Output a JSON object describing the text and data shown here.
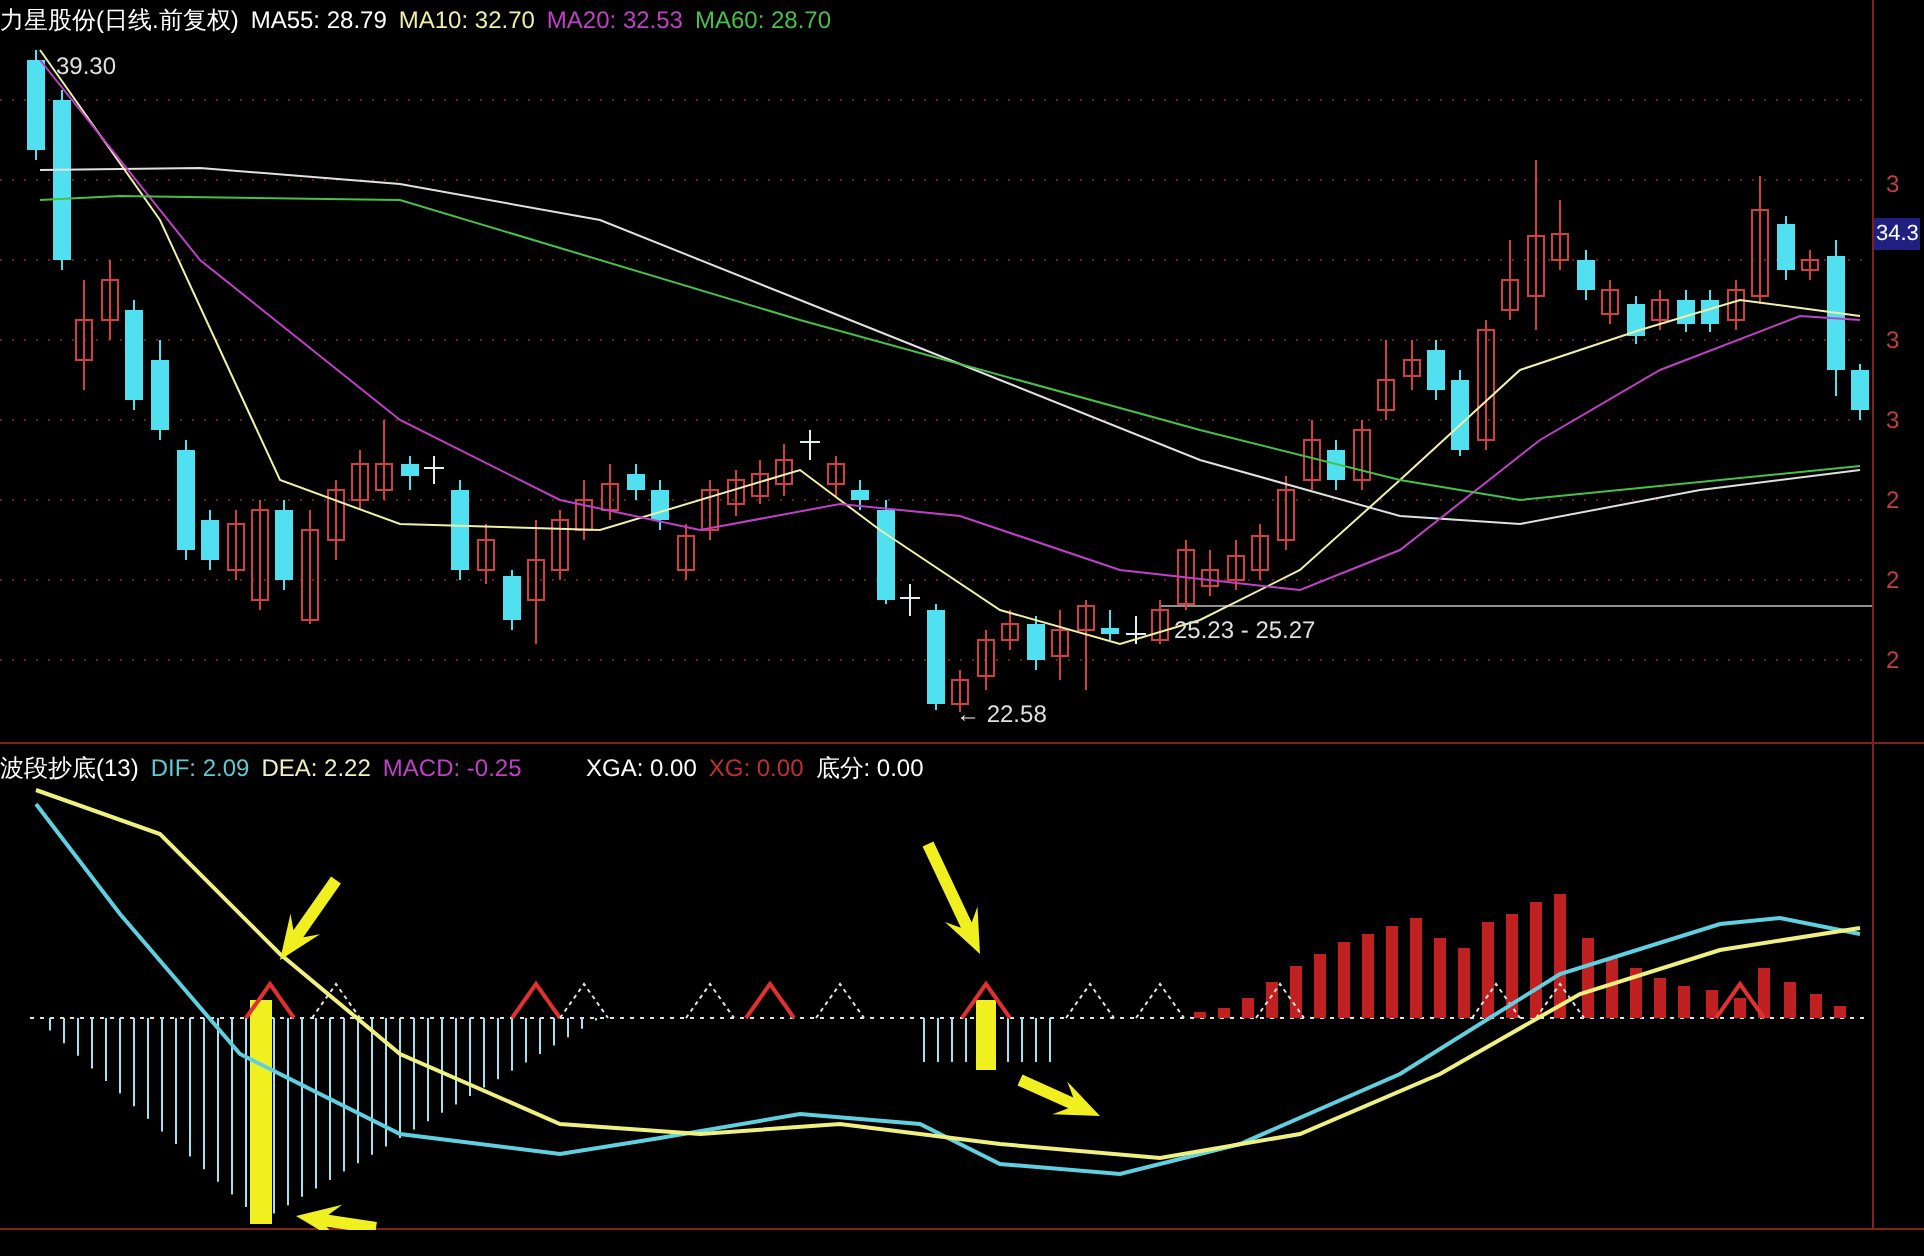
{
  "price_panel": {
    "title": {
      "label": "力星股份(日线.前复权)",
      "color": "#ffffff"
    },
    "legend": [
      {
        "label": "MA55: 28.79",
        "color": "#ffffff"
      },
      {
        "label": "MA10: 32.70",
        "color": "#f0f0a8"
      },
      {
        "label": "MA20: 32.53",
        "color": "#c040c8"
      },
      {
        "label": "MA60: 28.70",
        "color": "#48c048"
      }
    ],
    "annotations": [
      {
        "kind": "high",
        "label": "39.30"
      },
      {
        "kind": "low",
        "label": "← 22.58"
      },
      {
        "kind": "range",
        "label": "25.23 - 25.27"
      }
    ],
    "price_tag": "34.3",
    "axis_labels": [
      "3",
      "3",
      "3",
      "2",
      "2",
      "2"
    ]
  },
  "indicator_panel": {
    "title": {
      "label": "波段抄底(13)",
      "color": "#ffffff"
    },
    "legend": [
      {
        "label": "DIF: 2.09",
        "color": "#60c8d0"
      },
      {
        "label": "DEA: 2.22",
        "color": "#f0f0c0"
      },
      {
        "label": "MACD: -0.25",
        "color": "#c040c8"
      }
    ],
    "signals": [
      {
        "label": "XGA: 0.00",
        "color": "#ffffff"
      },
      {
        "label": "XG: 0.00",
        "color": "#c03030"
      },
      {
        "label": "底分: 0.00",
        "color": "#ffffff"
      }
    ]
  }
}
